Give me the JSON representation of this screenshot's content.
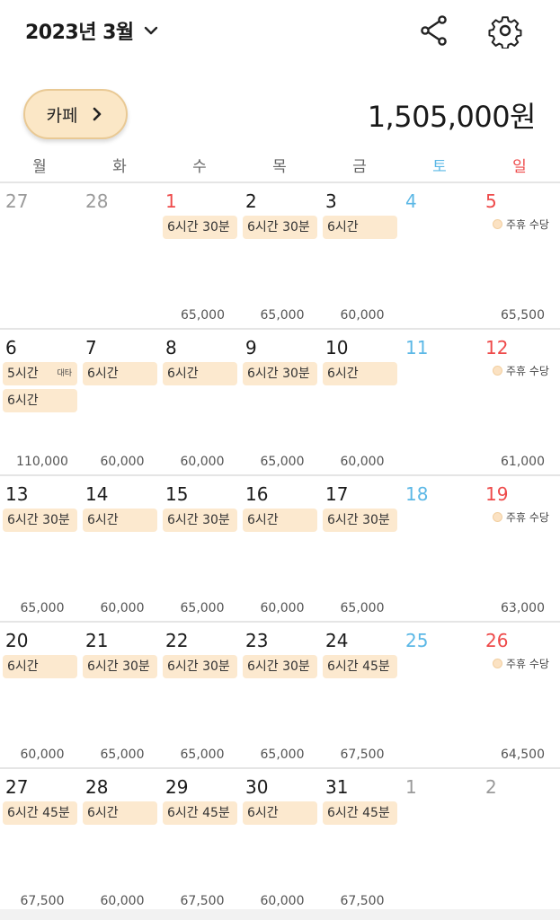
{
  "header": {
    "month_title": "2023년 3월",
    "icons": {
      "dropdown": "chevron-down-icon",
      "share": "share-icon",
      "settings": "gear-icon"
    }
  },
  "workplace": {
    "label": "카페",
    "icon": "chevron-right-icon"
  },
  "total_amount": "1,505,000원",
  "colors": {
    "accent_bg": "#fce9cf",
    "saturday": "#5cb8e6",
    "sunday": "#ee4a4a"
  },
  "weekdays": [
    "월",
    "화",
    "수",
    "목",
    "금",
    "토",
    "일"
  ],
  "weeks": [
    [
      {
        "day": "27",
        "other": true,
        "shifts": [],
        "amount": ""
      },
      {
        "day": "28",
        "other": true,
        "shifts": [],
        "amount": ""
      },
      {
        "day": "1",
        "holiday": true,
        "shifts": [
          "6시간 30분"
        ],
        "amount": "65,000"
      },
      {
        "day": "2",
        "shifts": [
          "6시간 30분"
        ],
        "amount": "65,000"
      },
      {
        "day": "3",
        "shifts": [
          "6시간"
        ],
        "amount": "60,000"
      },
      {
        "day": "4",
        "shifts": [],
        "amount": ""
      },
      {
        "day": "5",
        "allowance": "주휴 수당",
        "shifts": [],
        "amount": "65,500"
      }
    ],
    [
      {
        "day": "6",
        "shifts": [
          "5시간",
          "6시간"
        ],
        "substitute_tag": "대타",
        "amount": "110,000"
      },
      {
        "day": "7",
        "shifts": [
          "6시간"
        ],
        "amount": "60,000"
      },
      {
        "day": "8",
        "shifts": [
          "6시간"
        ],
        "amount": "60,000"
      },
      {
        "day": "9",
        "shifts": [
          "6시간 30분"
        ],
        "amount": "65,000"
      },
      {
        "day": "10",
        "shifts": [
          "6시간"
        ],
        "amount": "60,000"
      },
      {
        "day": "11",
        "shifts": [],
        "amount": ""
      },
      {
        "day": "12",
        "allowance": "주휴 수당",
        "shifts": [],
        "amount": "61,000"
      }
    ],
    [
      {
        "day": "13",
        "shifts": [
          "6시간 30분"
        ],
        "amount": "65,000"
      },
      {
        "day": "14",
        "shifts": [
          "6시간"
        ],
        "amount": "60,000"
      },
      {
        "day": "15",
        "shifts": [
          "6시간 30분"
        ],
        "amount": "65,000"
      },
      {
        "day": "16",
        "shifts": [
          "6시간"
        ],
        "amount": "60,000"
      },
      {
        "day": "17",
        "shifts": [
          "6시간 30분"
        ],
        "amount": "65,000"
      },
      {
        "day": "18",
        "shifts": [],
        "amount": ""
      },
      {
        "day": "19",
        "allowance": "주휴 수당",
        "shifts": [],
        "amount": "63,000"
      }
    ],
    [
      {
        "day": "20",
        "shifts": [
          "6시간"
        ],
        "amount": "60,000"
      },
      {
        "day": "21",
        "shifts": [
          "6시간 30분"
        ],
        "amount": "65,000"
      },
      {
        "day": "22",
        "shifts": [
          "6시간 30분"
        ],
        "amount": "65,000"
      },
      {
        "day": "23",
        "shifts": [
          "6시간 30분"
        ],
        "amount": "65,000"
      },
      {
        "day": "24",
        "shifts": [
          "6시간 45분"
        ],
        "amount": "67,500"
      },
      {
        "day": "25",
        "shifts": [],
        "amount": ""
      },
      {
        "day": "26",
        "allowance": "주휴 수당",
        "shifts": [],
        "amount": "64,500"
      }
    ],
    [
      {
        "day": "27",
        "shifts": [
          "6시간 45분"
        ],
        "amount": "67,500"
      },
      {
        "day": "28",
        "shifts": [
          "6시간"
        ],
        "amount": "60,000"
      },
      {
        "day": "29",
        "shifts": [
          "6시간 45분"
        ],
        "amount": "67,500"
      },
      {
        "day": "30",
        "shifts": [
          "6시간"
        ],
        "amount": "60,000"
      },
      {
        "day": "31",
        "shifts": [
          "6시간 45분"
        ],
        "amount": "67,500"
      },
      {
        "day": "1",
        "other": true,
        "shifts": [],
        "amount": ""
      },
      {
        "day": "2",
        "other": true,
        "shifts": [],
        "amount": ""
      }
    ]
  ]
}
